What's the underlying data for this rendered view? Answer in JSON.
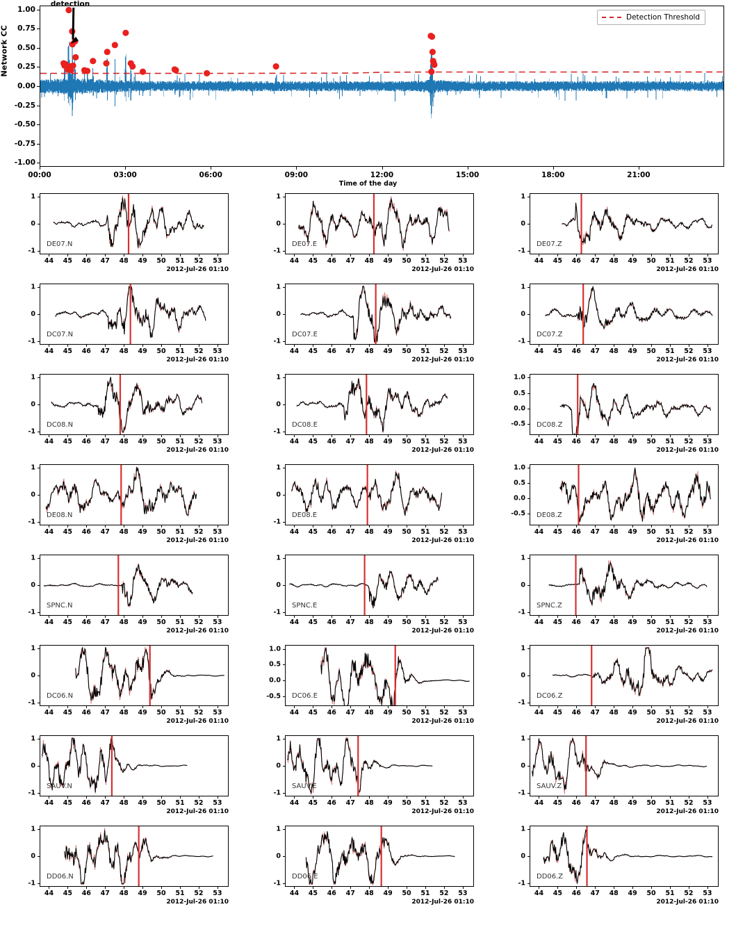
{
  "figure": {
    "kind": "seismic-template-matching-detection-figure",
    "colors": {
      "cc_trace": "#1f77b4",
      "detection_marker": "#e8211f",
      "threshold": "#d62728",
      "template_waveform": "#000000",
      "continuous_waveform": "#c94a4a",
      "pick_line": "#d6302f",
      "axis": "#000000"
    }
  },
  "cc_panel": {
    "ylabel": "Network CC",
    "xlabel": "Time of the day",
    "annotation": "detection",
    "legend": {
      "label": "Detection Threshold",
      "style": "dashed"
    },
    "yticks": [
      "1.00",
      "0.75",
      "0.50",
      "0.25",
      "0.00",
      "-0.25",
      "-0.50",
      "-0.75",
      "-1.00"
    ],
    "ytick_values": [
      1.0,
      0.75,
      0.5,
      0.25,
      0.0,
      -0.25,
      -0.5,
      -0.75,
      -1.0
    ],
    "ylim": [
      -1.05,
      1.05
    ],
    "xticks": [
      "00:00",
      "03:00",
      "06:00",
      "09:00",
      "12:00",
      "15:00",
      "18:00",
      "21:00"
    ],
    "xtick_hours": [
      0,
      3,
      6,
      9,
      12,
      15,
      18,
      21
    ],
    "xlim_hours": [
      0,
      24
    ]
  },
  "chart_data": {
    "type": "line",
    "title": "",
    "xlabel": "Time of the day",
    "ylabel": "Network CC",
    "xlim": [
      0,
      24
    ],
    "ylim": [
      -1.05,
      1.05
    ],
    "grid": false,
    "legend_position": "upper right",
    "series": [
      {
        "name": "Network CC",
        "color": "#1f77b4",
        "type": "line"
      },
      {
        "name": "Detection Threshold",
        "color": "#d62728",
        "type": "line",
        "style": "dashed",
        "description": "slowly varying threshold near 0.17 rising to about 0.19 after 12:00",
        "values_hours": [
          0,
          3,
          6,
          9,
          11,
          12,
          13.5,
          18,
          24
        ],
        "values_cc": [
          0.168,
          0.168,
          0.168,
          0.17,
          0.172,
          0.183,
          0.186,
          0.186,
          0.187
        ]
      },
      {
        "name": "Detections",
        "color": "#e8211f",
        "type": "scatter",
        "points": [
          {
            "hour": 0.82,
            "cc": 0.3
          },
          {
            "hour": 0.85,
            "cc": 0.27
          },
          {
            "hour": 0.88,
            "cc": 0.29
          },
          {
            "hour": 0.95,
            "cc": 0.22
          },
          {
            "hour": 1.0,
            "cc": 1.0
          },
          {
            "hour": 1.02,
            "cc": 0.25
          },
          {
            "hour": 1.05,
            "cc": 0.26
          },
          {
            "hour": 1.08,
            "cc": 0.21
          },
          {
            "hour": 1.12,
            "cc": 0.72
          },
          {
            "hour": 1.13,
            "cc": 0.55
          },
          {
            "hour": 1.15,
            "cc": 0.27
          },
          {
            "hour": 1.22,
            "cc": 0.59
          },
          {
            "hour": 1.24,
            "cc": 0.38
          },
          {
            "hour": 1.55,
            "cc": 0.21
          },
          {
            "hour": 1.65,
            "cc": 0.2
          },
          {
            "hour": 1.85,
            "cc": 0.33
          },
          {
            "hour": 2.35,
            "cc": 0.45
          },
          {
            "hour": 2.32,
            "cc": 0.3
          },
          {
            "hour": 2.62,
            "cc": 0.54
          },
          {
            "hour": 3.0,
            "cc": 0.7
          },
          {
            "hour": 3.18,
            "cc": 0.3
          },
          {
            "hour": 3.24,
            "cc": 0.26
          },
          {
            "hour": 3.6,
            "cc": 0.19
          },
          {
            "hour": 4.72,
            "cc": 0.22
          },
          {
            "hour": 4.76,
            "cc": 0.21
          },
          {
            "hour": 5.85,
            "cc": 0.17
          },
          {
            "hour": 8.28,
            "cc": 0.26
          },
          {
            "hour": 13.72,
            "cc": 0.66
          },
          {
            "hour": 13.76,
            "cc": 0.65
          },
          {
            "hour": 13.78,
            "cc": 0.45
          },
          {
            "hour": 13.8,
            "cc": 0.33
          },
          {
            "hour": 13.82,
            "cc": 0.3
          },
          {
            "hour": 13.84,
            "cc": 0.28
          },
          {
            "hour": 13.74,
            "cc": 0.19
          }
        ]
      }
    ],
    "annotations": [
      {
        "text": "detection",
        "hour": 1.8,
        "cc": 1.06,
        "arrow_to_hour": 1.05,
        "arrow_to_cc": 0.56
      }
    ]
  },
  "waveform_panels": {
    "xlabel": "2012-Jul-26 01:10",
    "default_yticks": [
      "1",
      "0",
      "-1"
    ],
    "default_ytick_values": [
      1,
      0,
      -1
    ],
    "xticks": [
      "44",
      "45",
      "46",
      "47",
      "48",
      "49",
      "50",
      "51",
      "52",
      "53"
    ],
    "xtick_values": [
      44,
      45,
      46,
      47,
      48,
      49,
      50,
      51,
      52,
      53
    ],
    "xlim": [
      43.5,
      53.6
    ],
    "rows": [
      {
        "station": "DE07",
        "cells": [
          {
            "label": "DE07.N",
            "pick": 48.25,
            "start": 44.2,
            "end": 52.3,
            "yticks": [
              "1",
              "0",
              "-1"
            ],
            "ytick_values": [
              1,
              0,
              -1
            ],
            "ylim": [
              -1.12,
              1.12
            ],
            "env": "mid",
            "seed": 11
          },
          {
            "label": "DE07.E",
            "pick": 48.25,
            "start": 44.2,
            "end": 52.3,
            "yticks": [
              "1",
              "0",
              "-1"
            ],
            "ytick_values": [
              1,
              0,
              -1
            ],
            "ylim": [
              -1.12,
              1.12
            ],
            "env": "osc",
            "seed": 12
          },
          {
            "label": "DE07.Z",
            "pick": 46.25,
            "start": 45.2,
            "end": 53.3,
            "yticks": [
              "1",
              "0",
              "-1"
            ],
            "ytick_values": [
              1,
              0,
              -1
            ],
            "ylim": [
              -1.12,
              1.12
            ],
            "env": "early",
            "seed": 13
          }
        ]
      },
      {
        "station": "DC07",
        "cells": [
          {
            "label": "DC07.N",
            "pick": 48.35,
            "start": 44.3,
            "end": 52.4,
            "yticks": [
              "1",
              "0",
              "-1"
            ],
            "ytick_values": [
              1,
              0,
              -1
            ],
            "ylim": [
              -1.12,
              1.12
            ],
            "env": "mid",
            "seed": 21
          },
          {
            "label": "DC07.E",
            "pick": 48.35,
            "start": 44.3,
            "end": 52.4,
            "yticks": [
              "1",
              "0",
              "-1"
            ],
            "ytick_values": [
              1,
              0,
              -1
            ],
            "ylim": [
              -1.12,
              1.12
            ],
            "env": "mid",
            "seed": 22
          },
          {
            "label": "DC07.Z",
            "pick": 46.35,
            "start": 44.3,
            "end": 53.3,
            "yticks": [
              "1",
              "0",
              "-1"
            ],
            "ytick_values": [
              1,
              0,
              -1
            ],
            "ylim": [
              -1.12,
              1.12
            ],
            "env": "early",
            "seed": 23
          }
        ]
      },
      {
        "station": "DC08",
        "cells": [
          {
            "label": "DC08.N",
            "pick": 47.8,
            "start": 44.1,
            "end": 52.2,
            "yticks": [
              "1",
              "0",
              "-1"
            ],
            "ytick_values": [
              1,
              0,
              -1
            ],
            "ylim": [
              -1.12,
              1.12
            ],
            "env": "mid",
            "seed": 31
          },
          {
            "label": "DC08.E",
            "pick": 47.85,
            "start": 44.1,
            "end": 52.2,
            "yticks": [
              "1",
              "0",
              "-1"
            ],
            "ytick_values": [
              1,
              0,
              -1
            ],
            "ylim": [
              -1.12,
              1.12
            ],
            "env": "mid",
            "seed": 32
          },
          {
            "label": "DC08.Z",
            "pick": 46.05,
            "start": 45.1,
            "end": 53.2,
            "yticks": [
              "1.0",
              "0.5",
              "0.0",
              "-0.5"
            ],
            "ytick_values": [
              1,
              0.5,
              0,
              -0.5
            ],
            "ylim": [
              -0.85,
              1.12
            ],
            "env": "early",
            "seed": 33
          }
        ]
      },
      {
        "station": "DE08",
        "cells": [
          {
            "label": "DE08.N",
            "pick": 47.85,
            "start": 43.8,
            "end": 51.9,
            "yticks": [
              "1",
              "0",
              "-1"
            ],
            "ytick_values": [
              1,
              0,
              -1
            ],
            "ylim": [
              -1.12,
              1.12
            ],
            "env": "osc",
            "seed": 41
          },
          {
            "label": "DE08.E",
            "pick": 47.9,
            "start": 43.8,
            "end": 51.9,
            "yticks": [
              "1",
              "0",
              "-1"
            ],
            "ytick_values": [
              1,
              0,
              -1
            ],
            "ylim": [
              -1.12,
              1.12
            ],
            "env": "osc",
            "seed": 42
          },
          {
            "label": "DE08.Z",
            "pick": 46.1,
            "start": 45.1,
            "end": 53.2,
            "yticks": [
              "1.0",
              "0.5",
              "0.0",
              "-0.5"
            ],
            "ytick_values": [
              1,
              0.5,
              0,
              -0.5
            ],
            "ylim": [
              -0.9,
              1.12
            ],
            "env": "osc",
            "seed": 43
          }
        ]
      },
      {
        "station": "SPNC",
        "cells": [
          {
            "label": "SPNC.N",
            "pick": 47.7,
            "start": 43.7,
            "end": 51.7,
            "yticks": [
              "1",
              "0",
              "-1"
            ],
            "ytick_values": [
              1,
              0,
              -1
            ],
            "ylim": [
              -1.12,
              1.12
            ],
            "env": "burst",
            "seed": 51
          },
          {
            "label": "SPNC.E",
            "pick": 47.75,
            "start": 43.7,
            "end": 51.7,
            "yticks": [
              "1",
              "0",
              "-1"
            ],
            "ytick_values": [
              1,
              0,
              -1
            ],
            "ylim": [
              -1.12,
              1.12
            ],
            "env": "burst",
            "seed": 52
          },
          {
            "label": "SPNC.Z",
            "pick": 45.95,
            "start": 44.5,
            "end": 53.0,
            "yticks": [
              "1",
              "0",
              "-1"
            ],
            "ytick_values": [
              1,
              0,
              -1
            ],
            "ylim": [
              -1.12,
              1.12
            ],
            "env": "burst2",
            "seed": 53
          }
        ]
      },
      {
        "station": "DC06",
        "cells": [
          {
            "label": "DC06.N",
            "pick": 49.4,
            "start": 45.4,
            "end": 53.4,
            "yticks": [
              "1",
              "0",
              "-1"
            ],
            "ytick_values": [
              1,
              0,
              -1
            ],
            "ylim": [
              -1.12,
              1.12
            ],
            "env": "impulse",
            "seed": 61
          },
          {
            "label": "DC06.E",
            "pick": 49.4,
            "start": 45.4,
            "end": 53.4,
            "yticks": [
              "1.0",
              "0.5",
              "0.0",
              "-0.5"
            ],
            "ytick_values": [
              1,
              0.5,
              0,
              -0.5
            ],
            "ylim": [
              -0.8,
              1.12
            ],
            "env": "impulse",
            "seed": 62
          },
          {
            "label": "DC06.Z",
            "pick": 46.8,
            "start": 44.7,
            "end": 53.3,
            "yticks": [
              "1",
              "0",
              "-1"
            ],
            "ytick_values": [
              1,
              0,
              -1
            ],
            "ylim": [
              -1.12,
              1.12
            ],
            "env": "impulse2",
            "seed": 63
          }
        ]
      },
      {
        "station": "SAUV",
        "cells": [
          {
            "label": "SAUV.N",
            "pick": 47.35,
            "start": 43.6,
            "end": 51.4,
            "yticks": [
              "1",
              "0",
              "-1"
            ],
            "ytick_values": [
              1,
              0,
              -1
            ],
            "ylim": [
              -1.12,
              1.12
            ],
            "env": "impulse",
            "seed": 71
          },
          {
            "label": "SAUV.E",
            "pick": 47.4,
            "start": 43.6,
            "end": 51.4,
            "yticks": [
              "1",
              "0",
              "-1"
            ],
            "ytick_values": [
              1,
              0,
              -1
            ],
            "ylim": [
              -1.12,
              1.12
            ],
            "env": "impulse",
            "seed": 72
          },
          {
            "label": "SAUV.Z",
            "pick": 46.5,
            "start": 43.6,
            "end": 53.0,
            "yticks": [
              "1",
              "0",
              "-1"
            ],
            "ytick_values": [
              1,
              0,
              -1
            ],
            "ylim": [
              -1.12,
              1.12
            ],
            "env": "impulse3",
            "seed": 73
          }
        ]
      },
      {
        "station": "DD06",
        "cells": [
          {
            "label": "DD06.N",
            "pick": 48.8,
            "start": 44.8,
            "end": 52.8,
            "yticks": [
              "1",
              "0",
              "-1"
            ],
            "ytick_values": [
              1,
              0,
              -1
            ],
            "ylim": [
              -1.12,
              1.12
            ],
            "env": "impulse",
            "seed": 81
          },
          {
            "label": "DD06.E",
            "pick": 48.65,
            "start": 44.6,
            "end": 52.6,
            "yticks": [
              "1",
              "0",
              "-1"
            ],
            "ytick_values": [
              1,
              0,
              -1
            ],
            "ylim": [
              -1.12,
              1.12
            ],
            "env": "impulse",
            "seed": 82
          },
          {
            "label": "DD06.Z",
            "pick": 46.55,
            "start": 44.2,
            "end": 53.3,
            "yticks": [
              "1",
              "0",
              "-1"
            ],
            "ytick_values": [
              1,
              0,
              -1
            ],
            "ylim": [
              -1.12,
              1.12
            ],
            "env": "impulse3",
            "seed": 83
          }
        ]
      }
    ]
  }
}
